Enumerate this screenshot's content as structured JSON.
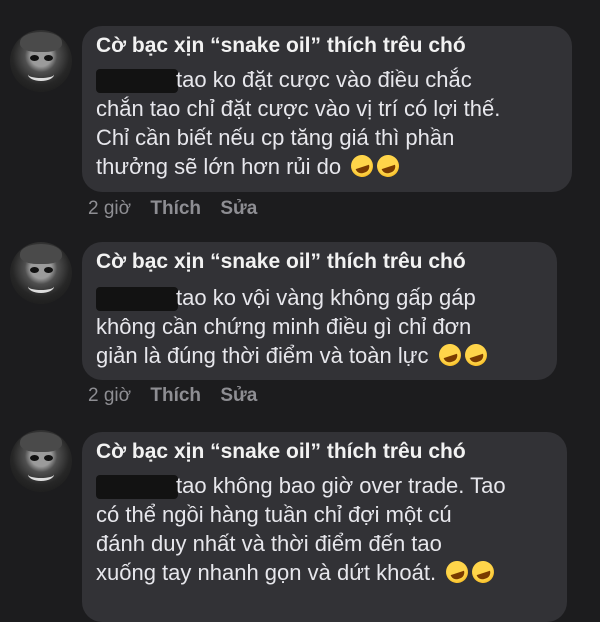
{
  "comments": [
    {
      "author": "Cờ bạc xịn  “snake oil” thích trêu chó",
      "lines": [
        "tao ko đặt cược vào điều chắc",
        "chắn tao chỉ đặt cược vào vị trí có lợi thế.",
        "Chỉ cần biết nếu cp tăng giá thì phần",
        "thưởng sẽ lớn hơn rủi do"
      ],
      "emoji": [
        "rolling-on-floor-laughing",
        "rolling-on-floor-laughing"
      ],
      "time": "2 giờ",
      "like_label": "Thích",
      "edit_label": "Sửa"
    },
    {
      "author": "Cờ bạc xịn  “snake oil” thích trêu chó",
      "lines": [
        "tao ko vội vàng không gấp gáp",
        "không cần chứng minh điều gì chỉ đơn",
        "giản là đúng thời điểm và toàn lực"
      ],
      "emoji": [
        "rolling-on-floor-laughing",
        "rolling-on-floor-laughing"
      ],
      "time": "2 giờ",
      "like_label": "Thích",
      "edit_label": "Sửa"
    },
    {
      "author": "Cờ bạc xịn  “snake oil” thích trêu chó",
      "lines": [
        "tao không bao giờ over trade. Tao",
        "có thể ngồi hàng tuần chỉ đợi một cú",
        "đánh duy nhất và thời điểm đến tao",
        "xuống tay nhanh gọn và dứt khoát."
      ],
      "emoji": [
        "rolling-on-floor-laughing",
        "rolling-on-floor-laughing"
      ]
    }
  ]
}
